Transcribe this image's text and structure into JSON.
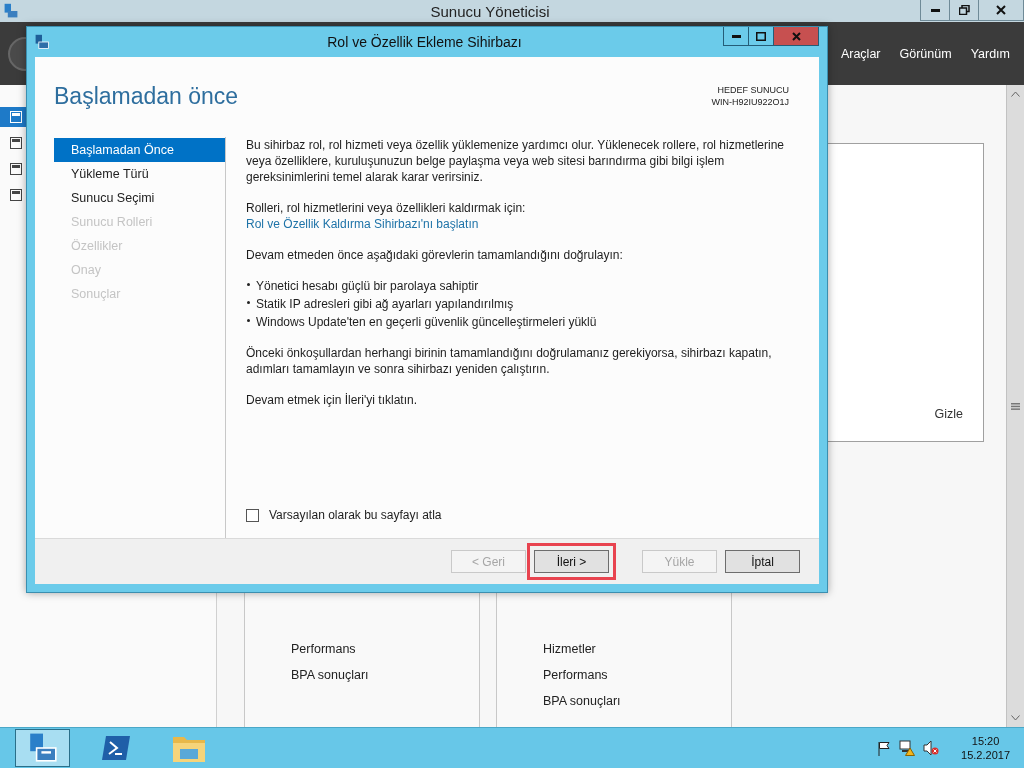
{
  "app_window": {
    "title": "Sunucu Yöneticisi",
    "menu": [
      "Araçlar",
      "Görünüm",
      "Yardım"
    ],
    "nav_icons": [
      {
        "selected": true
      },
      {
        "selected": false
      },
      {
        "selected": false
      },
      {
        "selected": false
      }
    ]
  },
  "panel": {
    "link": "Gizle"
  },
  "tiles": [
    {
      "items": [
        "Performans",
        "BPA sonuçları"
      ]
    },
    {
      "items": [
        "Hizmetler",
        "Performans",
        "BPA sonuçları"
      ]
    }
  ],
  "dialog": {
    "title": "Rol ve Özellik Ekleme Sihirbazı",
    "heading": "Başlamadan önce",
    "target_label": "HEDEF SUNUCU",
    "target_server": "WIN-H92IU922O1J",
    "steps": [
      {
        "label": "Başlamadan Önce",
        "selected": true,
        "disabled": false
      },
      {
        "label": "Yükleme Türü",
        "selected": false,
        "disabled": false
      },
      {
        "label": "Sunucu Seçimi",
        "selected": false,
        "disabled": false
      },
      {
        "label": "Sunucu Rolleri",
        "selected": false,
        "disabled": true
      },
      {
        "label": "Özellikler",
        "selected": false,
        "disabled": true
      },
      {
        "label": "Onay",
        "selected": false,
        "disabled": true
      },
      {
        "label": "Sonuçlar",
        "selected": false,
        "disabled": true
      }
    ],
    "content": [
      {
        "kind": "paragraph",
        "text": "Bu sihirbaz rol, rol hizmeti veya özellik yüklemenize yardımcı olur. Yüklenecek rollere, rol hizmetlerine veya özelliklere, kuruluşunuzun belge paylaşma veya web sitesi barındırma gibi bilgi işlem gereksinimlerini temel alarak karar verirsiniz."
      },
      {
        "kind": "link-group",
        "text": "Rolleri, rol hizmetlerini veya özellikleri kaldırmak için:",
        "link": "Rol ve Özellik Kaldırma Sihirbazı'nı başlatın"
      },
      {
        "kind": "paragraph",
        "text": "Devam etmeden önce aşağıdaki görevlerin tamamlandığını doğrulayın:"
      },
      {
        "kind": "bullets",
        "items": [
          "Yönetici hesabı güçlü bir parolaya sahiptir",
          "Statik IP adresleri gibi ağ ayarları yapılandırılmış",
          "Windows Update'ten en geçerli güvenlik güncelleştirmeleri yüklü"
        ]
      },
      {
        "kind": "paragraph",
        "text": "Önceki önkoşullardan herhangi birinin tamamlandığını doğrulamanız gerekiyorsa, sihirbazı kapatın, adımları tamamlayın ve sonra sihirbazı yeniden çalıştırın."
      },
      {
        "kind": "paragraph",
        "text": "Devam etmek için İleri'yi tıklatın."
      }
    ],
    "checkbox": {
      "label": "Varsayılan olarak bu sayfayı atla",
      "checked": false
    },
    "buttons": [
      {
        "label": "< Geri",
        "disabled": true,
        "highlighted": false
      },
      {
        "label": "İleri >",
        "disabled": false,
        "highlighted": true
      },
      {
        "label": "Yükle",
        "disabled": true,
        "highlighted": false
      },
      {
        "label": "İptal",
        "disabled": false,
        "highlighted": false
      }
    ]
  },
  "taskbar": {
    "apps": [
      {
        "kind": "server",
        "selected": true
      },
      {
        "kind": "shell",
        "selected": false
      },
      {
        "kind": "folder",
        "selected": false
      }
    ],
    "time": "15:20",
    "date": "15.2.2017"
  }
}
